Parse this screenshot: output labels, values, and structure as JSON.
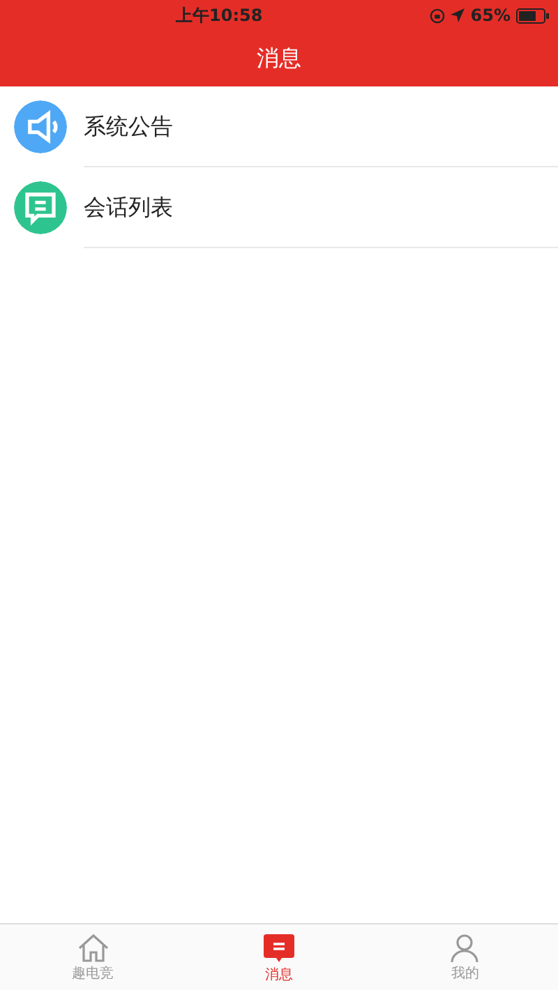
{
  "status_bar": {
    "time": "上午10:58",
    "battery": "65%"
  },
  "header": {
    "title": "消息"
  },
  "items": [
    {
      "kind": "announcement",
      "label": "系统公告"
    },
    {
      "kind": "chat",
      "label": "会话列表"
    }
  ],
  "tabs": [
    {
      "kind": "home",
      "label": "趣电竞",
      "selected": false
    },
    {
      "kind": "message",
      "label": "消息",
      "selected": true
    },
    {
      "kind": "profile",
      "label": "我的",
      "selected": false
    }
  ]
}
